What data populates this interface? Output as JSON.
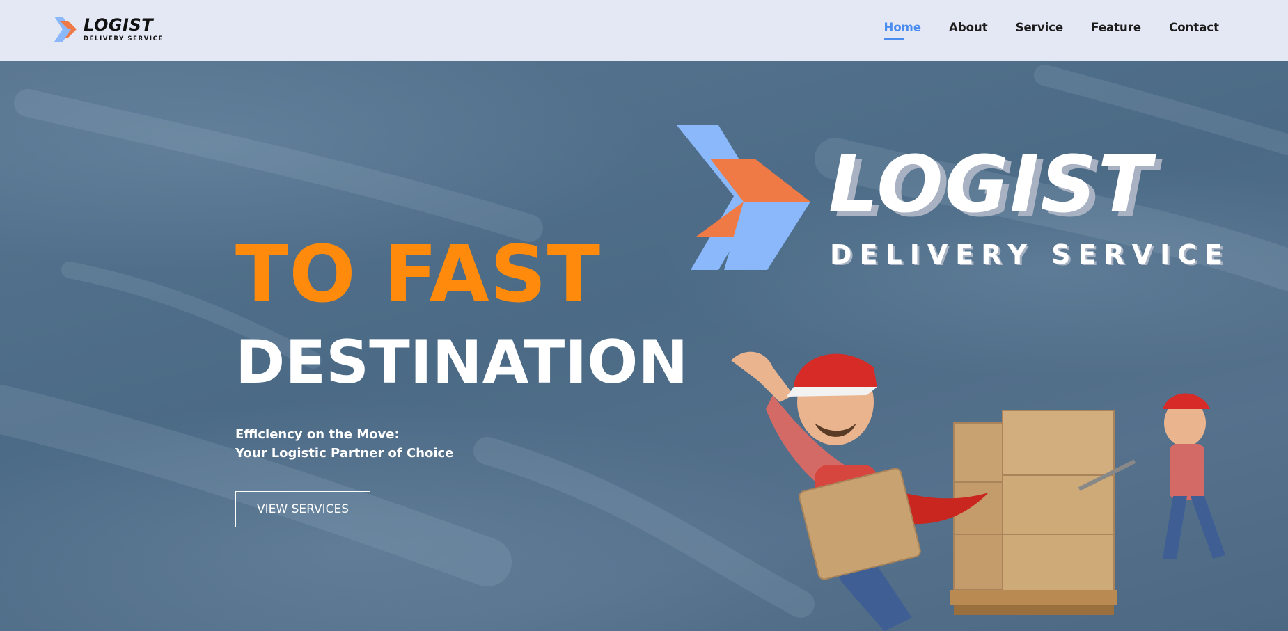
{
  "brand": {
    "name": "LOGIST",
    "tagline": "DELIVERY SERVICE"
  },
  "nav": {
    "items": [
      {
        "label": "Home",
        "active": true
      },
      {
        "label": "About",
        "active": false
      },
      {
        "label": "Service",
        "active": false
      },
      {
        "label": "Feature",
        "active": false
      },
      {
        "label": "Contact",
        "active": false
      }
    ]
  },
  "hero": {
    "headline_1": "TO FAST",
    "headline_2": "DESTINATION",
    "sub_line_1": "Efficiency on the Move:",
    "sub_line_2": "Your Logistic Partner of Choice",
    "cta_label": "VIEW SERVICES",
    "logo_word": "LOGIST",
    "logo_tagline": "DELIVERY SERVICE"
  },
  "colors": {
    "header_bg": "#e4e8f4",
    "nav_active": "#4a8cf0",
    "headline_orange": "#ff8a0c",
    "logo_blue": "#8ab8fb",
    "logo_orange": "#ef7a45",
    "hero_bg": "#4d6a84"
  },
  "icons": {
    "brand_mark": "double-chevron-icon",
    "illustration": "delivery-man-with-boxes-illustration"
  }
}
